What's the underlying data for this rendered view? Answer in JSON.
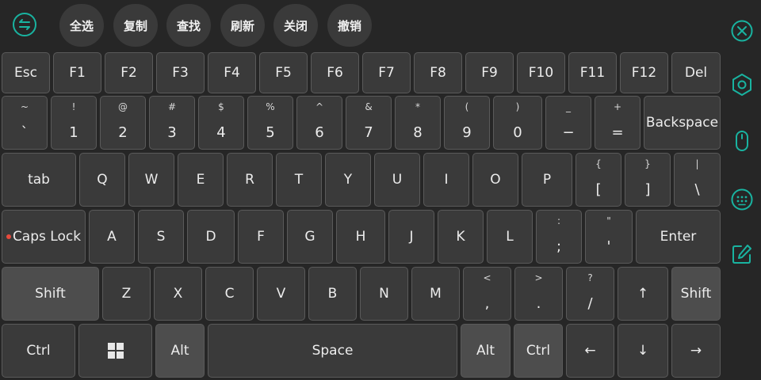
{
  "toolbar": {
    "buttons": [
      "全选",
      "复制",
      "查找",
      "刷新",
      "关闭",
      "撤销"
    ]
  },
  "colors": {
    "accent": "#19b3a0",
    "background": "#262626",
    "key": "#3a3a3a",
    "mod_key": "#4d4d4d",
    "caps_indicator": "#e84a3c"
  },
  "side_icons": [
    "close-icon",
    "settings-gear-icon",
    "mouse-icon",
    "keypad-icon",
    "edit-icon"
  ],
  "keys": {
    "row1": [
      "Esc",
      "F1",
      "F2",
      "F3",
      "F4",
      "F5",
      "F6",
      "F7",
      "F8",
      "F9",
      "F10",
      "F11",
      "F12",
      "Del"
    ],
    "row2": [
      {
        "top": "~",
        "main": "`"
      },
      {
        "top": "!",
        "main": "1"
      },
      {
        "top": "@",
        "main": "2"
      },
      {
        "top": "#",
        "main": "3"
      },
      {
        "top": "$",
        "main": "4"
      },
      {
        "top": "%",
        "main": "5"
      },
      {
        "top": "^",
        "main": "6"
      },
      {
        "top": "&",
        "main": "7"
      },
      {
        "top": "*",
        "main": "8"
      },
      {
        "top": "(",
        "main": "9"
      },
      {
        "top": ")",
        "main": "0"
      },
      {
        "top": "_",
        "main": "−"
      },
      {
        "top": "+",
        "main": "="
      }
    ],
    "backspace": "Backspace",
    "tab": "tab",
    "row3": [
      "Q",
      "W",
      "E",
      "R",
      "T",
      "Y",
      "U",
      "I",
      "O",
      "P"
    ],
    "row3_sym": [
      {
        "top": "{",
        "main": "["
      },
      {
        "top": "}",
        "main": "]"
      },
      {
        "top": "|",
        "main": "\\"
      }
    ],
    "caps": "Caps Lock",
    "row4": [
      "A",
      "S",
      "D",
      "F",
      "G",
      "H",
      "J",
      "K",
      "L"
    ],
    "row4_sym": [
      {
        "top": ":",
        "main": ";"
      },
      {
        "top": "\"",
        "main": "'"
      }
    ],
    "enter": "Enter",
    "shift": "Shift",
    "row5": [
      "Z",
      "X",
      "C",
      "V",
      "B",
      "N",
      "M"
    ],
    "row5_sym": [
      {
        "top": "<",
        "main": ","
      },
      {
        "top": ">",
        "main": "."
      },
      {
        "top": "?",
        "main": "/"
      }
    ],
    "up": "↑",
    "ctrl": "Ctrl",
    "alt": "Alt",
    "space": "Space",
    "left": "←",
    "down": "↓",
    "right": "→"
  }
}
